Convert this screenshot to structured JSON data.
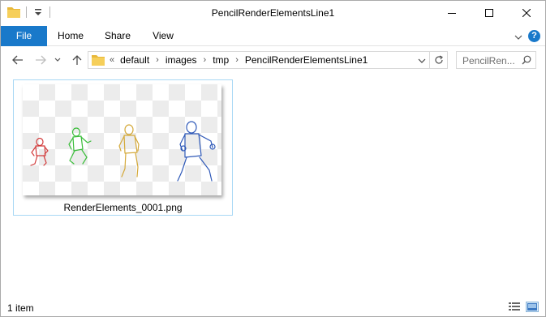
{
  "window": {
    "title": "PencilRenderElementsLine1"
  },
  "ribbon": {
    "tabs": [
      "File",
      "Home",
      "Share",
      "View"
    ],
    "help_label": "?"
  },
  "address": {
    "lead": "«",
    "crumbs": [
      "default",
      "images",
      "tmp",
      "PencilRenderElementsLine1"
    ]
  },
  "search": {
    "placeholder": "PencilRen..."
  },
  "files": [
    {
      "name": "RenderElements_0001.png",
      "selected": true
    }
  ],
  "status": {
    "count": "1 item"
  },
  "colors": {
    "file_tab": "#1979ca",
    "folder": "#f6cf5a",
    "selection_border": "#a8d8f5",
    "figure_red": "#d23a3a",
    "figure_green": "#3bbd3b",
    "figure_yellow": "#d4a93a",
    "figure_blue": "#2f59b8"
  }
}
